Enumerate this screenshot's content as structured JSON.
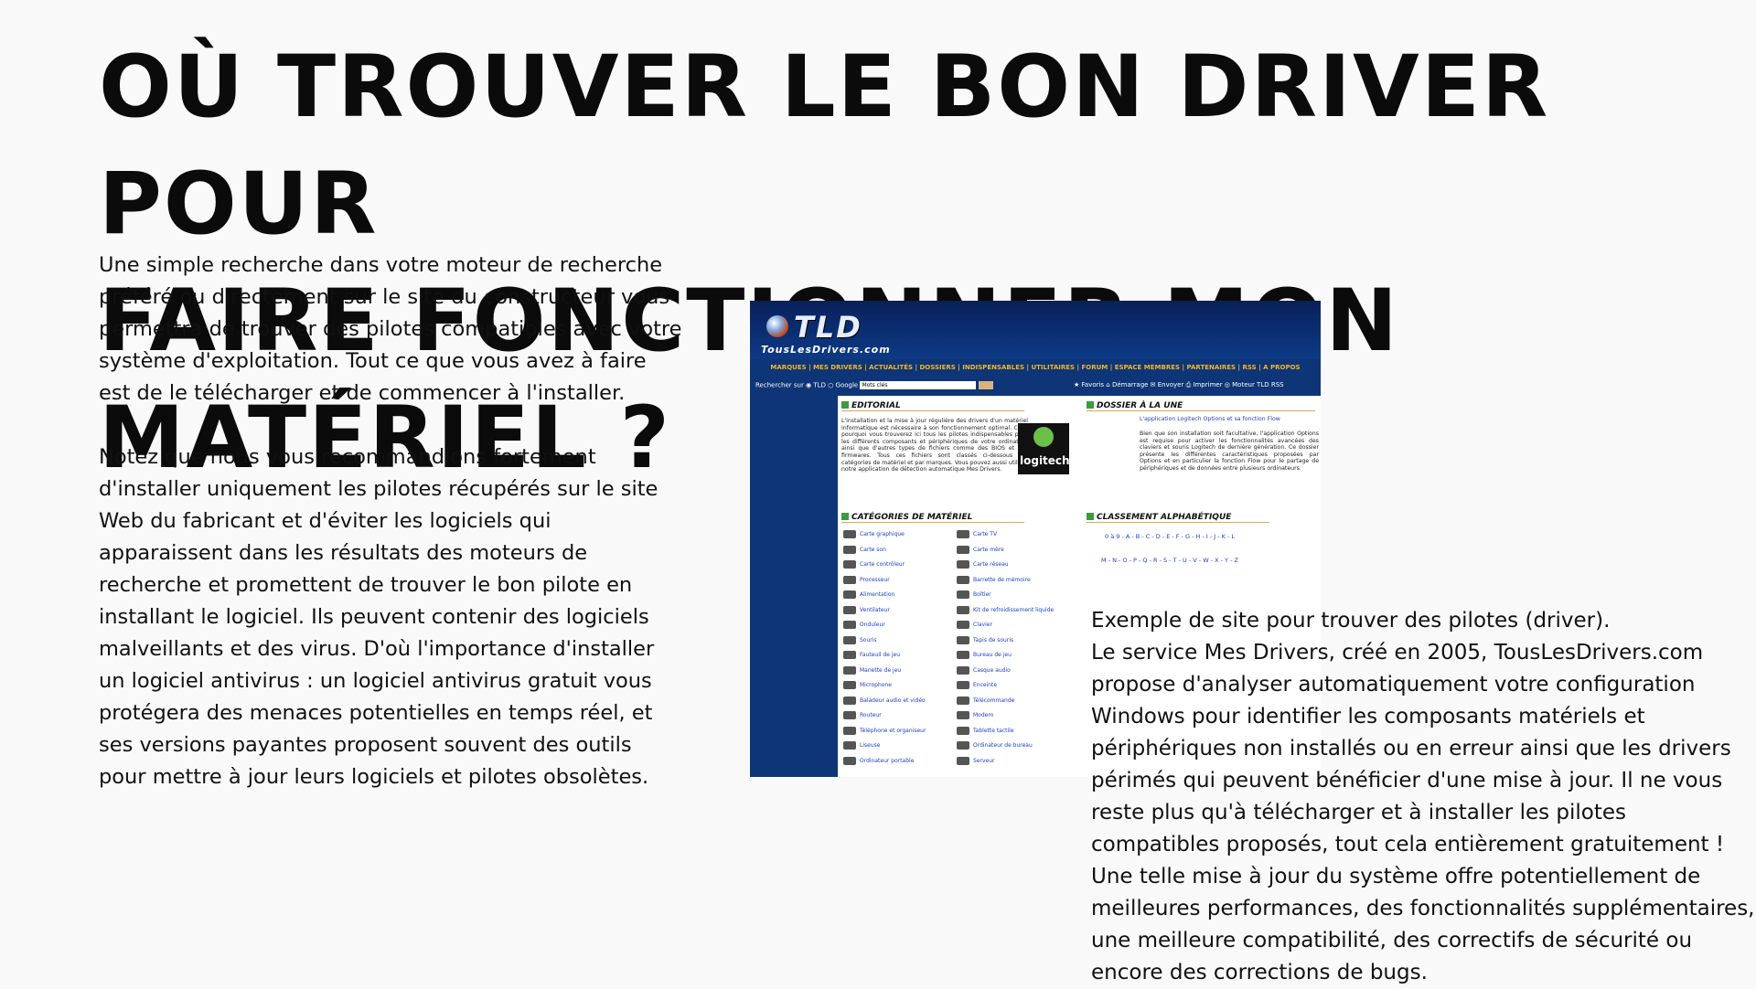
{
  "title": {
    "line1": "OÙ TROUVER LE BON DRIVER POUR",
    "line2": "FAIRE FONCTIONNER MON MATÉRIEL ?"
  },
  "paragraphs": {
    "p1": "Une simple recherche dans votre moteur de recherche préféré ou directement sur le site du constructeur vous permettra de trouver des pilotes compatibles avec votre système d'exploitation. Tout ce que vous avez à faire est de le télécharger et de commencer à l'installer.",
    "p2": "Notez que nous vous recommandions fortement d'installer uniquement les pilotes récupérés sur le site Web du fabricant et d'éviter les logiciels qui apparaissent dans les résultats des moteurs de recherche et promettent de trouver le bon pilote en installant le logiciel. Ils peuvent contenir des logiciels malveillants et des virus. D'où l'importance d'installer un logiciel antivirus : un logiciel antivirus gratuit vous protégera des menaces potentielles en temps réel, et ses versions payantes proposent souvent des outils pour mettre à jour leurs logiciels et pilotes obsolètes."
  },
  "caption": {
    "line1": "Exemple de site pour trouver des pilotes (driver).",
    "body": "Le service Mes Drivers, créé en 2005, TousLesDrivers.com propose d'analyser automatiquement votre configuration Windows pour identifier les composants matériels et périphériques non installés ou en erreur ainsi que les drivers périmés qui peuvent bénéficier d'une mise à jour. Il ne vous reste plus qu'à télécharger et à installer les pilotes compatibles proposés, tout cela entièrement gratuitement ! Une telle mise à jour du système offre potentiellement de meilleures performances, des fonctionnalités supplémentaires, une meilleure compatibilité, des correctifs de sécurité ou encore des corrections de bugs."
  },
  "screenshot": {
    "logo": "TLD",
    "logo_sub": "TousLesDrivers.com",
    "menu": "MARQUES | MES DRIVERS | ACTUALITÉS | DOSSIERS | INDISPENSABLES | UTILITAIRES | FORUM | ESPACE MEMBRES | PARTENAIRES | RSS | A PROPOS",
    "search_label": "Rechercher sur",
    "search_opt1": "TLD",
    "search_opt2": "Google",
    "search_placeholder": "Mots clés",
    "right_links": "★ Favoris  ⌂ Démarrage  ✉ Envoyer  ⎙ Imprimer  ◎ Moteur TLD  RSS",
    "editorial_title": "EDITORIAL",
    "editorial_text": "L'installation et la mise à jour régulière des drivers d'un matériel informatique est nécessaire à son fonctionnement optimal. C'est pourquoi vous trouverez ici tous les pilotes indispensables pour les différents composants et périphériques de votre ordinateur ainsi que d'autres types de fichiers comme des BIOS et des firmwares. Tous ces fichiers sont classés ci-dessous par catégories de matériel et par marques. Vous pouvez aussi utiliser notre application de détection automatique Mes Drivers.",
    "dossier_title": "DOSSIER À LA UNE",
    "dossier_link": "L'application Logitech Options et sa fonction Flow",
    "dossier_text": "Bien que son installation soit facultative, l'application Options est requise pour activer les fonctionnalités avancées des claviers et souris Logitech de dernière génération. Ce dossier présente les différentes caractéristiques proposées par Options et en particulier la fonction Flow pour le partage de périphériques et de données entre plusieurs ordinateurs.",
    "logitech": "logitech",
    "categories_title": "CATÉGORIES DE MATÉRIEL",
    "categories_left": [
      "Carte graphique",
      "Carte son",
      "Carte contrôleur",
      "Processeur",
      "Alimentation",
      "Ventilateur",
      "Onduleur",
      "Souris",
      "Fauteuil de jeu",
      "Manette de jeu",
      "Microphone",
      "Baladeur audio et vidéo",
      "Routeur",
      "Téléphone et organiseur",
      "Liseuse",
      "Ordinateur portable"
    ],
    "categories_right": [
      "Carte TV",
      "Carte mère",
      "Carte réseau",
      "Barrette de mémoire",
      "Boîtier",
      "Kit de refroidissement liquide",
      "Clavier",
      "Tapis de souris",
      "Bureau de jeu",
      "Casque audio",
      "Enceinte",
      "Télécommande",
      "Modem",
      "Tablette tactile",
      "Ordinateur de bureau",
      "Serveur"
    ],
    "alpha_title": "CLASSEMENT ALPHABÉTIQUE",
    "alpha_row1": "0 à 9 - A - B - C - D - E - F - G - H - I - J - K - L",
    "alpha_row2": "M - N - O - P - Q - R - S - T - U - V - W - X - Y - Z"
  }
}
